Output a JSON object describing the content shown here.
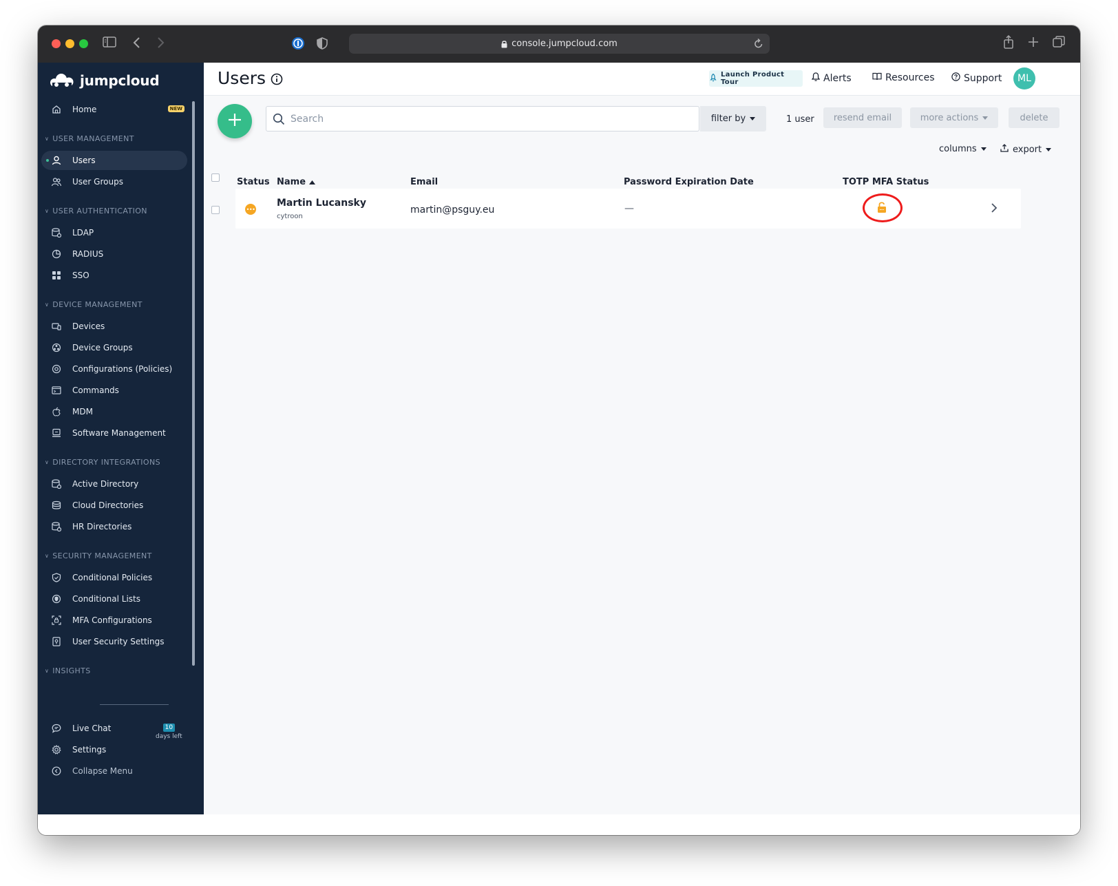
{
  "browser": {
    "url": "console.jumpcloud.com"
  },
  "brand": {
    "name": "jumpcloud"
  },
  "sidebar": {
    "home": {
      "label": "Home",
      "badge": "NEW"
    },
    "sections": {
      "user_management": "USER MANAGEMENT",
      "user_authentication": "USER AUTHENTICATION",
      "device_management": "DEVICE MANAGEMENT",
      "directory_integrations": "DIRECTORY INTEGRATIONS",
      "security_management": "SECURITY MANAGEMENT",
      "insights": "INSIGHTS"
    },
    "items": {
      "users": "Users",
      "user_groups": "User Groups",
      "ldap": "LDAP",
      "radius": "RADIUS",
      "sso": "SSO",
      "devices": "Devices",
      "device_groups": "Device Groups",
      "configurations": "Configurations (Policies)",
      "commands": "Commands",
      "mdm": "MDM",
      "software_management": "Software Management",
      "active_directory": "Active Directory",
      "cloud_directories": "Cloud Directories",
      "hr_directories": "HR Directories",
      "conditional_policies": "Conditional Policies",
      "conditional_lists": "Conditional Lists",
      "mfa_configurations": "MFA Configurations",
      "user_security_settings": "User Security Settings"
    },
    "footer": {
      "live_chat": "Live Chat",
      "trial_days": "10",
      "trial_text": "days left",
      "settings": "Settings",
      "collapse": "Collapse Menu"
    }
  },
  "header": {
    "title": "Users",
    "launch_tour": "Launch Product Tour",
    "alerts": "Alerts",
    "resources": "Resources",
    "support": "Support",
    "avatar_initials": "ML"
  },
  "toolbar": {
    "search_placeholder": "Search",
    "filter_by": "filter by",
    "user_count": "1 user",
    "resend_email": "resend email",
    "more_actions": "more actions",
    "delete": "delete",
    "columns": "columns",
    "export": "export"
  },
  "table": {
    "columns": [
      "Status",
      "Name",
      "Email",
      "Password Expiration Date",
      "TOTP MFA Status"
    ],
    "rows": [
      {
        "name": "Martin Lucansky",
        "username": "cytroon",
        "email": "martin@psguy.eu",
        "password_expiration": "—",
        "status": "pending",
        "mfa_status": "unlocked"
      }
    ]
  },
  "colors": {
    "sidebar_bg": "#15253b",
    "accent_green": "#35bd8a",
    "status_pending": "#f5a623",
    "highlight_ring": "#ee1c1c"
  }
}
